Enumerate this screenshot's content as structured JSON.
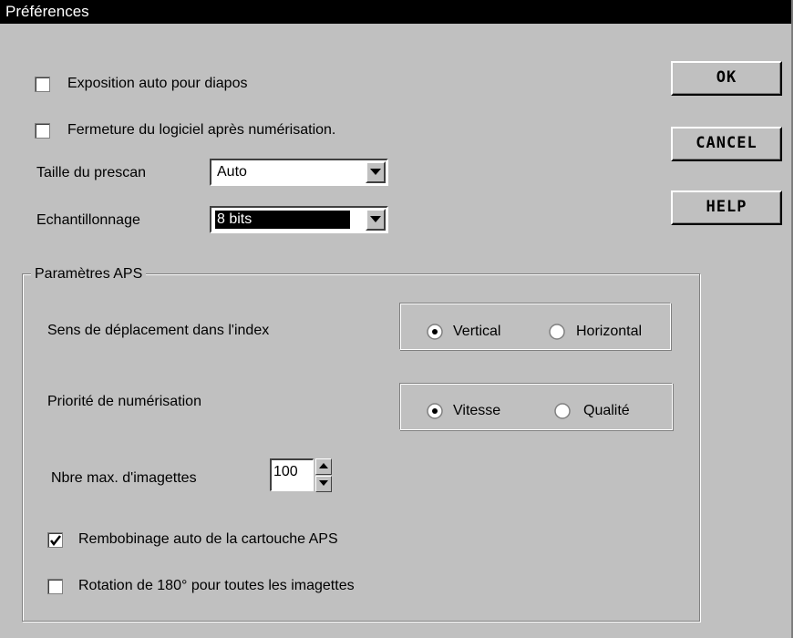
{
  "window": {
    "title": "Préférences"
  },
  "options": {
    "auto_exposure": {
      "label": "Exposition auto pour diapos",
      "checked": false
    },
    "close_after_scan": {
      "label": "Fermeture du logiciel après numérisation.",
      "checked": false
    }
  },
  "prescan_size": {
    "label": "Taille du prescan",
    "value": "Auto"
  },
  "sampling": {
    "label": "Echantillonnage",
    "value": "8 bits"
  },
  "buttons": {
    "ok": "OK",
    "cancel": "CANCEL",
    "help": "HELP"
  },
  "aps": {
    "title": "Paramètres APS",
    "index_direction": {
      "label": "Sens de déplacement dans l'index",
      "options": [
        "Vertical",
        "Horizontal"
      ],
      "selected": "Vertical"
    },
    "scan_priority": {
      "label": "Priorité de numérisation",
      "options": [
        "Vitesse",
        "Qualité"
      ],
      "selected": "Vitesse"
    },
    "max_thumbnails": {
      "label": "Nbre max. d'imagettes",
      "value": "100"
    },
    "auto_rewind": {
      "label": "Rembobinage auto de la cartouche APS",
      "checked": true
    },
    "rotate_180": {
      "label": "Rotation de 180° pour toutes les imagettes",
      "checked": false
    }
  },
  "icons": {
    "dropdown": "chevron-down-icon",
    "spin_up": "arrow-up-icon",
    "spin_down": "arrow-down-icon",
    "check": "checkmark-icon",
    "radio_dot": "radio-dot-icon"
  }
}
